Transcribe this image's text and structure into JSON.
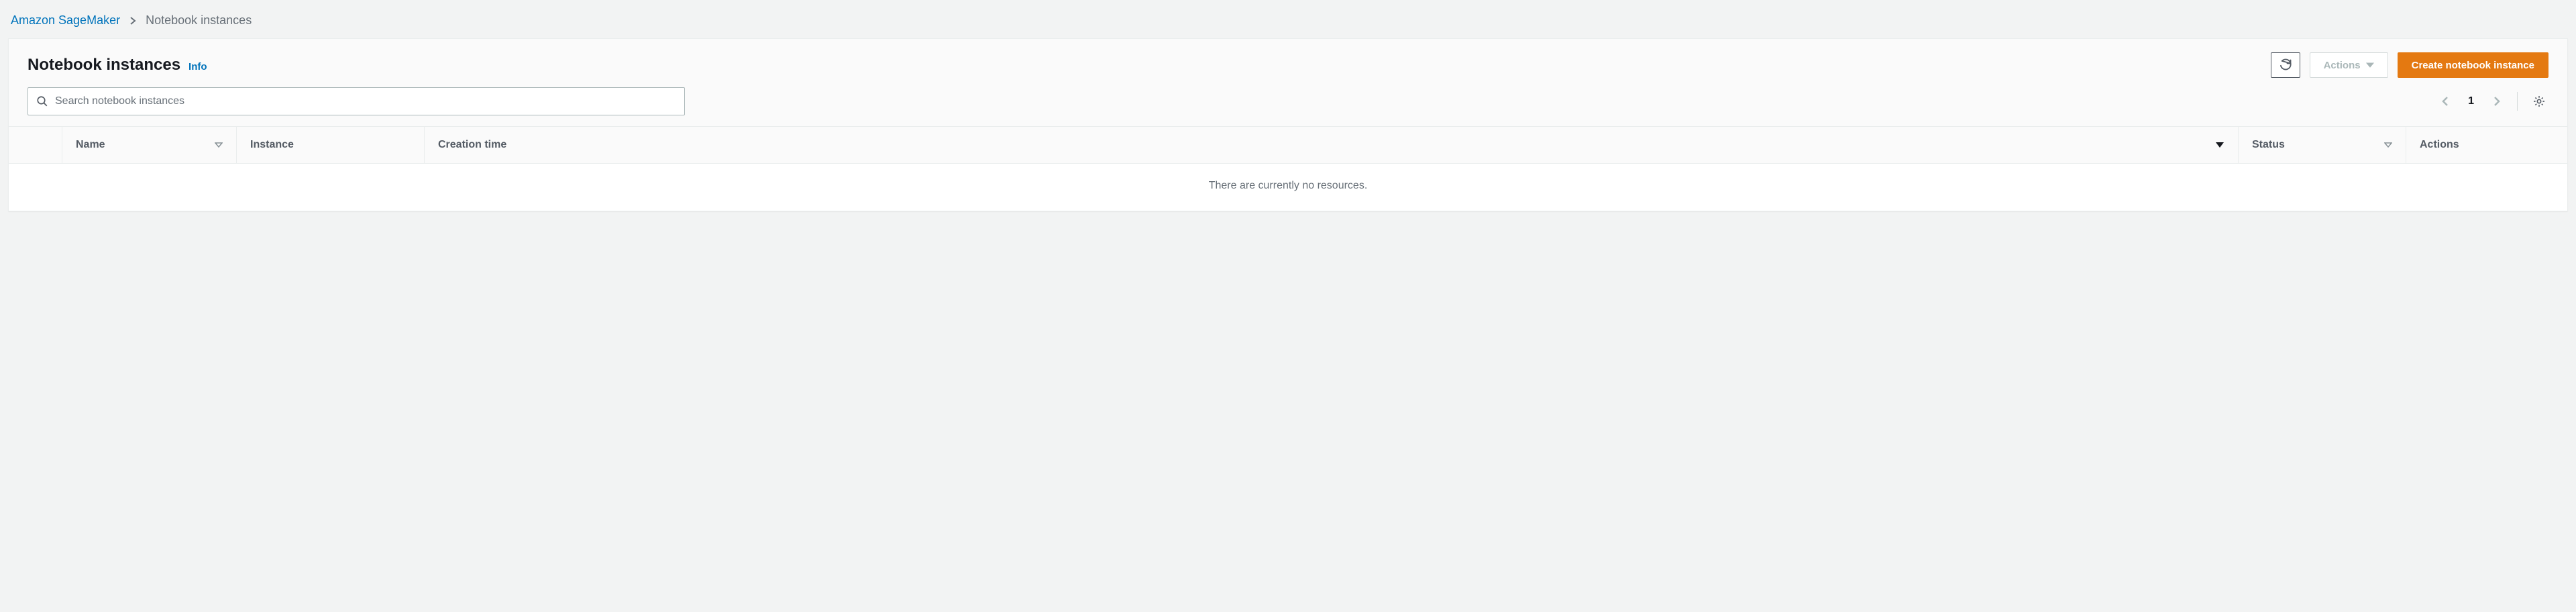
{
  "breadcrumb": {
    "root": "Amazon SageMaker",
    "current": "Notebook instances"
  },
  "header": {
    "title": "Notebook instances",
    "info": "Info",
    "actions_label": "Actions",
    "create_label": "Create notebook instance"
  },
  "search": {
    "placeholder": "Search notebook instances"
  },
  "pagination": {
    "page": "1"
  },
  "table": {
    "columns": {
      "name": "Name",
      "instance": "Instance",
      "creation_time": "Creation time",
      "status": "Status",
      "actions": "Actions"
    },
    "empty": "There are currently no resources."
  }
}
